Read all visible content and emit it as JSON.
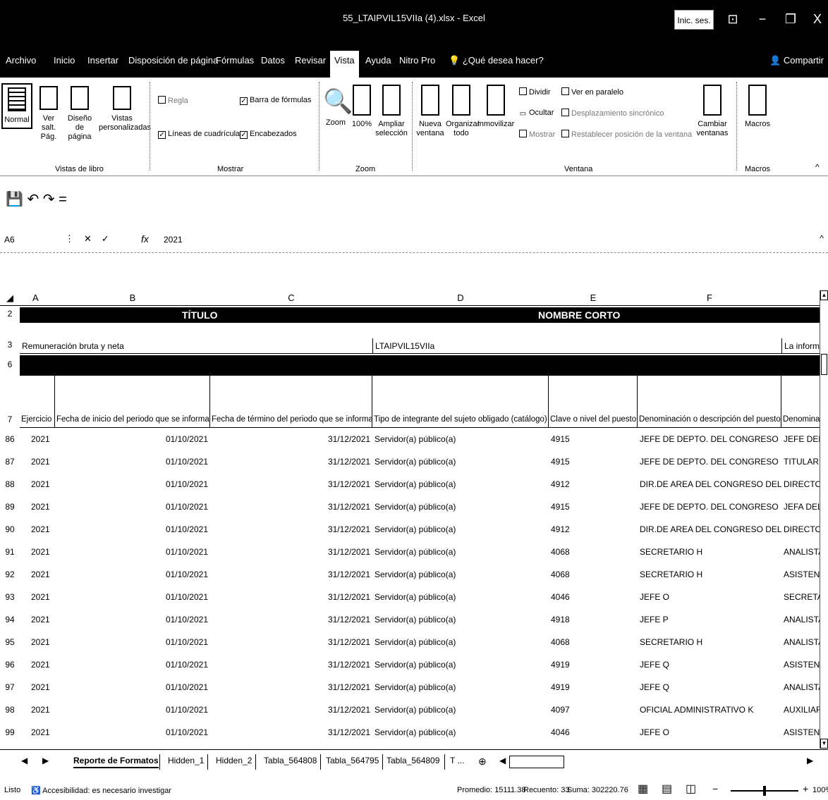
{
  "window": {
    "title": "55_LTAIPVIL15VIIa (4).xlsx - Excel",
    "sign_in": "Inic. ses.",
    "minimize": "−",
    "restore": "❐",
    "close": "X",
    "ribbon_display_icon": "⊡"
  },
  "tabs": [
    "Archivo",
    "Inicio",
    "Insertar",
    "Disposición de página",
    "Fórmulas",
    "Datos",
    "Revisar",
    "Vista",
    "Ayuda",
    "Nitro Pro"
  ],
  "active_tab": "Vista",
  "tell_me": "¿Qué desea hacer?",
  "share": "Compartir",
  "ribbon": {
    "views": {
      "normal": "Normal",
      "page_break": "Ver salt. Pág.",
      "page_layout": "Diseño de página",
      "custom_views": "Vistas personalizadas",
      "group_label": "Vistas de libro"
    },
    "show": {
      "ruler": "Regla",
      "gridlines": "Líneas de cuadrícula",
      "formula_bar": "Barra de fórmulas",
      "headings": "Encabezados",
      "group_label": "Mostrar"
    },
    "zoom": {
      "zoom": "Zoom",
      "zoom100": "100%",
      "zoom_selection": "Ampliar selección",
      "group_label": "Zoom"
    },
    "window": {
      "new_window": "Nueva ventana",
      "arrange_all": "Organizar todo",
      "freeze": "Inmovilizar",
      "split": "Dividir",
      "hide": "Ocultar",
      "unhide": "Mostrar",
      "side_by_side": "Ver en paralelo",
      "sync_scroll": "Desplazamiento sincrónico",
      "reset_position": "Restablecer posición de la ventana",
      "switch_windows": "Cambiar ventanas",
      "group_label": "Ventana"
    },
    "macros": {
      "macros": "Macros",
      "group_label": "Macros"
    }
  },
  "qat": [
    "💾",
    "↶",
    "↷",
    "="
  ],
  "formula_bar": {
    "name_box": "A6",
    "value": "2021"
  },
  "columns": [
    "A",
    "B",
    "C",
    "D",
    "E",
    "F"
  ],
  "sheet": {
    "row2": {
      "num": "2",
      "titulo": "TÍTULO",
      "nombre_corto": "NOMBRE CORTO"
    },
    "row3": {
      "num": "3",
      "a": "Remuneración bruta y neta",
      "d": "LTAIPVIL15VIIa",
      "g": "La informa"
    },
    "row6": {
      "num": "6"
    },
    "row7": {
      "num": "7",
      "headers": [
        "Ejercicio",
        "Fecha de inicio del periodo que se informa",
        "Fecha de término del periodo que se informa",
        "Tipo de integrante del sujeto obligado (catálogo)",
        "Clave o nivel del puesto",
        "Denominación o descripción del puesto",
        "Denomina"
      ]
    },
    "rows": [
      {
        "num": "86",
        "a": "2021",
        "b": "01/10/2021",
        "c": "31/12/2021",
        "d": "Servidor(a) público(a)",
        "e": "4915",
        "f": "JEFE DE DEPTO. DEL CONGRESO DEL ED",
        "g": "JEFE DEL D"
      },
      {
        "num": "87",
        "a": "2021",
        "b": "01/10/2021",
        "c": "31/12/2021",
        "d": "Servidor(a) público(a)",
        "e": "4915",
        "f": "JEFE DE DEPTO. DEL CONGRESO DEL ED",
        "g": "TITULAR D"
      },
      {
        "num": "88",
        "a": "2021",
        "b": "01/10/2021",
        "c": "31/12/2021",
        "d": "Servidor(a) público(a)",
        "e": "4912",
        "f": "DIR.DE AREA DEL CONGRESO DEL EDO.",
        "g": "DIRECTOR"
      },
      {
        "num": "89",
        "a": "2021",
        "b": "01/10/2021",
        "c": "31/12/2021",
        "d": "Servidor(a) público(a)",
        "e": "4915",
        "f": "JEFE DE DEPTO. DEL CONGRESO DEL ED",
        "g": "JEFA DEL"
      },
      {
        "num": "90",
        "a": "2021",
        "b": "01/10/2021",
        "c": "31/12/2021",
        "d": "Servidor(a) público(a)",
        "e": "4912",
        "f": "DIR.DE AREA DEL CONGRESO DEL EDO.",
        "g": "DIRECTOR"
      },
      {
        "num": "91",
        "a": "2021",
        "b": "01/10/2021",
        "c": "31/12/2021",
        "d": "Servidor(a) público(a)",
        "e": "4068",
        "f": "SECRETARIO H",
        "g": "ANALISTA"
      },
      {
        "num": "92",
        "a": "2021",
        "b": "01/10/2021",
        "c": "31/12/2021",
        "d": "Servidor(a) público(a)",
        "e": "4068",
        "f": "SECRETARIO H",
        "g": "ASISTENT"
      },
      {
        "num": "93",
        "a": "2021",
        "b": "01/10/2021",
        "c": "31/12/2021",
        "d": "Servidor(a) público(a)",
        "e": "4046",
        "f": "JEFE O",
        "g": "SECRETAR"
      },
      {
        "num": "94",
        "a": "2021",
        "b": "01/10/2021",
        "c": "31/12/2021",
        "d": "Servidor(a) público(a)",
        "e": "4918",
        "f": "JEFE P",
        "g": "ANALISTA"
      },
      {
        "num": "95",
        "a": "2021",
        "b": "01/10/2021",
        "c": "31/12/2021",
        "d": "Servidor(a) público(a)",
        "e": "4068",
        "f": "SECRETARIO H",
        "g": "ANALISTA"
      },
      {
        "num": "96",
        "a": "2021",
        "b": "01/10/2021",
        "c": "31/12/2021",
        "d": "Servidor(a) público(a)",
        "e": "4919",
        "f": "JEFE Q",
        "g": "ASISTENT"
      },
      {
        "num": "97",
        "a": "2021",
        "b": "01/10/2021",
        "c": "31/12/2021",
        "d": "Servidor(a) público(a)",
        "e": "4919",
        "f": "JEFE Q",
        "g": "ANALISTA"
      },
      {
        "num": "98",
        "a": "2021",
        "b": "01/10/2021",
        "c": "31/12/2021",
        "d": "Servidor(a) público(a)",
        "e": "4097",
        "f": "OFICIAL ADMINISTRATIVO K",
        "g": "AUXILIAR"
      },
      {
        "num": "99",
        "a": "2021",
        "b": "01/10/2021",
        "c": "31/12/2021",
        "d": "Servidor(a) público(a)",
        "e": "4046",
        "f": "JEFE O",
        "g": "ASISTENT"
      }
    ]
  },
  "sheet_tabs": [
    "Reporte de Formatos",
    "Hidden_1",
    "Hidden_2",
    "Tabla_564808",
    "Tabla_564795",
    "Tabla_564809",
    "T ..."
  ],
  "status": {
    "ready": "Listo",
    "accessibility": "Accesibilidad: es necesario investigar",
    "average": "Promedio: 15111.38",
    "count": "Recuento: 33",
    "sum": "Suma: 302220.76",
    "zoom": "100%"
  }
}
